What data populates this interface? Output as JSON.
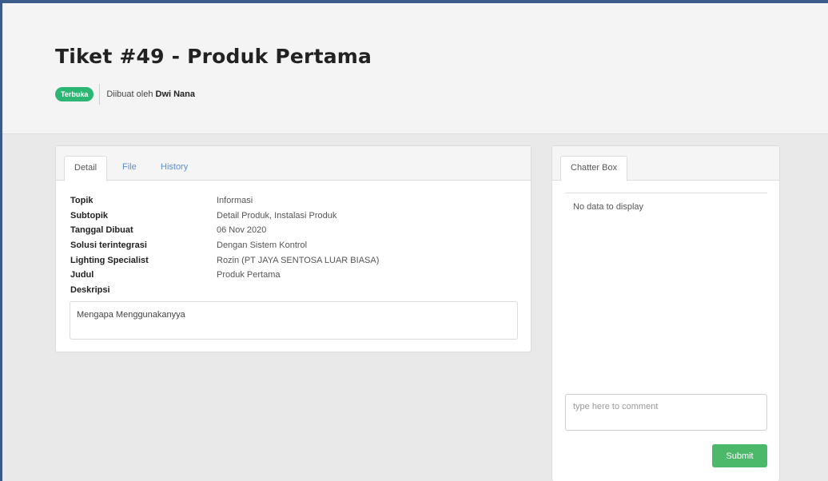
{
  "page": {
    "title": "Tiket #49 - Produk Pertama",
    "status": "Terbuka",
    "created_by_prefix": "Diibuat oleh",
    "created_by_name": "Dwi Nana"
  },
  "detail_tabs": [
    "Detail",
    "File",
    "History"
  ],
  "fields": [
    {
      "label": "Topik",
      "value": "Informasi"
    },
    {
      "label": "Subtopik",
      "value": "Detail Produk, Instalasi Produk"
    },
    {
      "label": "Tanggal Dibuat",
      "value": "06 Nov 2020"
    },
    {
      "label": "Solusi terintegrasi",
      "value": "Dengan Sistem Kontrol"
    },
    {
      "label": "Lighting Specialist",
      "value": "Rozin (PT JAYA SENTOSA LUAR BIASA)"
    },
    {
      "label": "Judul",
      "value": "Produk Pertama"
    },
    {
      "label": "Deskripsi",
      "value": ""
    }
  ],
  "description": "Mengapa Menggunakanyya",
  "chat": {
    "tab": "Chatter Box",
    "empty_text": "No data to display",
    "comment_placeholder": "type here to comment",
    "submit_label": "Submit"
  },
  "colors": {
    "frame": "#3c5a8a",
    "status_badge": "#2bb673",
    "submit_button": "#4cb96a",
    "tab_link": "#5a8fd0"
  }
}
